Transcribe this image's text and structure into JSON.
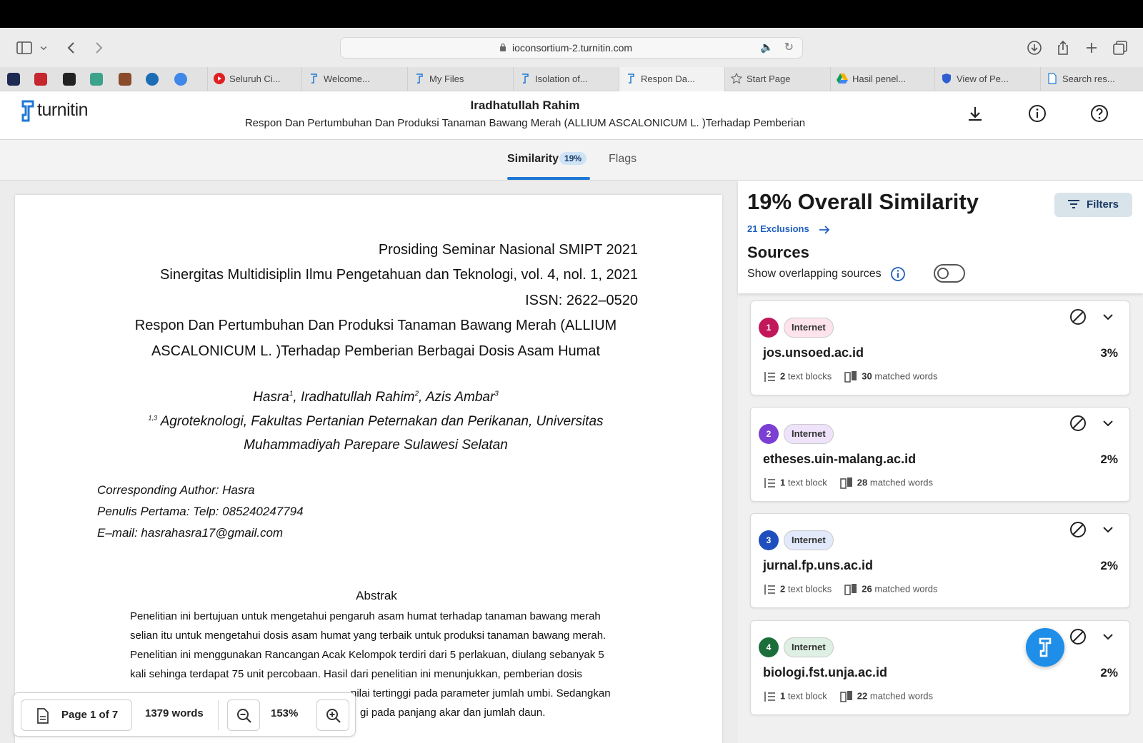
{
  "browser": {
    "url": "ioconsortium-2.turnitin.com",
    "tabs": [
      {
        "label": "Seluruh Ci..."
      },
      {
        "label": "Welcome..."
      },
      {
        "label": "My Files"
      },
      {
        "label": "Isolation of..."
      },
      {
        "label": "Respon Da..."
      },
      {
        "label": "Start Page"
      },
      {
        "label": "Hasil penel..."
      },
      {
        "label": "View of Pe..."
      },
      {
        "label": "Search res..."
      }
    ]
  },
  "header": {
    "logo_text": "turnitin",
    "author": "Iradhatullah Rahim",
    "doc_title": "Respon Dan Pertumbuhan Dan Produksi Tanaman Bawang Merah (ALLIUM ASCALONICUM L. )Terhadap Pemberian"
  },
  "subnav": {
    "similarity_label": "Similarity",
    "similarity_badge": "19%",
    "flags_label": "Flags"
  },
  "document": {
    "line1": "Prosiding Seminar Nasional SMIPT 2021",
    "line2": "Sinergitas Multidisiplin Ilmu Pengetahuan dan Teknologi, vol. 4, nol. 1, 2021",
    "line3": "ISSN: 2622–0520",
    "title1": "Respon Dan Pertumbuhan  Dan Produksi Tanaman Bawang Merah (ALLIUM",
    "title2": "ASCALONICUM L. )Terhadap Pemberian Berbagai Dosis Asam Humat",
    "author_a": "Hasra",
    "sup_a": "1",
    "author_b": ", Iradhatullah Rahim",
    "sup_b": "2",
    "author_c": ", Azis Ambar",
    "sup_c": "3",
    "aff_sup": "1,3",
    "aff1": "Agroteknologi, Fakultas Pertanian Peternakan dan Perikanan, Universitas",
    "aff2": "Muhammadiyah Parepare Sulawesi Selatan",
    "corr": "Corresponding Author: Hasra",
    "telp": "Penulis Pertama: Telp: 085240247794",
    "email": "E–mail: hasrahasra17@gmail.com",
    "abstrak_h": "Abstrak",
    "abs1": "Penelitian ini bertujuan untuk mengetahui pengaruh asam humat terhadap tanaman  bawang merah",
    "abs2": "selian itu untuk mengetahui dosis asam humat yang terbaik untuk produksi tanaman bawang merah.",
    "abs3": "Penelitian ini menggunakan  Rancangan Acak Kelompok terdiri dari 5 perlakuan, diulang sebanyak 5",
    "abs4": "kali sehinga terdapat 75 unit percobaan. Hasil dari  penelitian ini menunjukkan, pemberian dosis",
    "abs5": "nilai tertinggi pada parameter jumlah umbi. Sedangkan",
    "abs6": "gi pada panjang akar dan jumlah daun."
  },
  "pagebar": {
    "page_label": "Page 1 of 7",
    "words_label": "1379 words",
    "zoom_label": "153%"
  },
  "panel": {
    "overall": "19% Overall Similarity",
    "filters_label": "Filters",
    "exclusions": "21 Exclusions",
    "sources_heading": "Sources",
    "overlap_label": "Show overlapping sources",
    "overlap_on": false
  },
  "sources": [
    {
      "num": "1",
      "type": "Internet",
      "domain": "jos.unsoed.ac.id",
      "pct": "3%",
      "blocks": "2",
      "blocks_label": "text blocks",
      "words": "30",
      "words_label": "matched words",
      "color": "#c2185b"
    },
    {
      "num": "2",
      "type": "Internet",
      "domain": "etheses.uin-malang.ac.id",
      "pct": "2%",
      "blocks": "1",
      "blocks_label": "text block",
      "words": "28",
      "words_label": "matched words",
      "color": "#7b3fd4"
    },
    {
      "num": "3",
      "type": "Internet",
      "domain": "jurnal.fp.uns.ac.id",
      "pct": "2%",
      "blocks": "2",
      "blocks_label": "text blocks",
      "words": "26",
      "words_label": "matched words",
      "color": "#1f4fbf"
    },
    {
      "num": "4",
      "type": "Internet",
      "domain": "biologi.fst.unja.ac.id",
      "pct": "2%",
      "blocks": "1",
      "blocks_label": "text block",
      "words": "22",
      "words_label": "matched words",
      "color": "#1b6e3a"
    }
  ]
}
